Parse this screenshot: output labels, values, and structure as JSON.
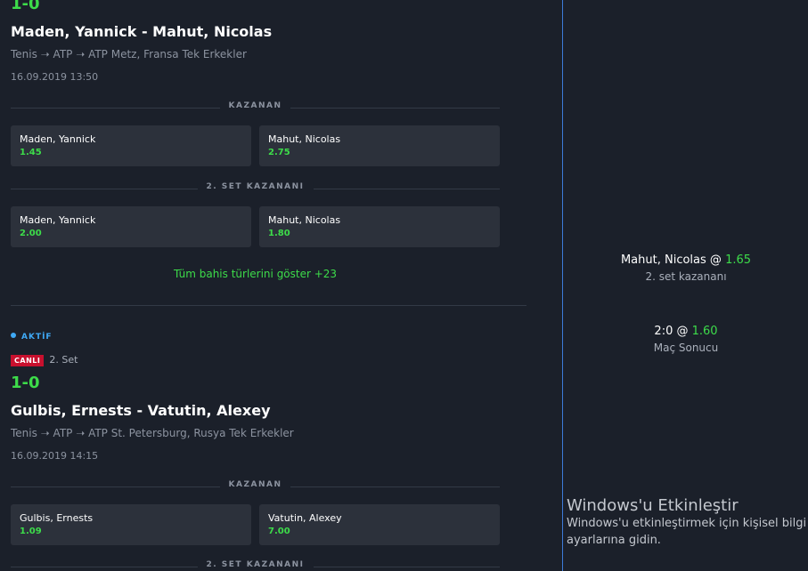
{
  "match1": {
    "score": "1-0",
    "title": "Maden, Yannick - Mahut, Nicolas",
    "breadcrumb": "Tenis ➝ ATP ➝ ATP Metz, Fransa Tek Erkekler",
    "date": "16.09.2019 13:50",
    "markets": [
      {
        "label": "KAZANAN",
        "left": {
          "name": "Maden, Yannick",
          "price": "1.45"
        },
        "right": {
          "name": "Mahut, Nicolas",
          "price": "2.75"
        }
      },
      {
        "label": "2. SET KAZANANI",
        "left": {
          "name": "Maden, Yannick",
          "price": "2.00"
        },
        "right": {
          "name": "Mahut, Nicolas",
          "price": "1.80"
        }
      }
    ],
    "show_all": "Tüm bahis türlerini göster +23"
  },
  "match2": {
    "status": "AKTİF",
    "live_badge": "CANLI",
    "period": "2. Set",
    "score": "1-0",
    "title": "Gulbis, Ernests - Vatutin, Alexey",
    "breadcrumb": "Tenis ➝ ATP ➝ ATP St. Petersburg, Rusya Tek Erkekler",
    "date": "16.09.2019 14:15",
    "markets": [
      {
        "label": "KAZANAN",
        "left": {
          "name": "Gulbis, Ernests",
          "price": "1.09"
        },
        "right": {
          "name": "Vatutin, Alexey",
          "price": "7.00"
        }
      },
      {
        "label": "2. SET KAZANANI"
      }
    ]
  },
  "betslip": [
    {
      "selection": "Mahut, Nicolas @",
      "price": "1.65",
      "market": "2. set kazananı"
    },
    {
      "selection": "2:0 @",
      "price": "1.60",
      "market": "Maç Sonucu"
    }
  ],
  "watermark": {
    "title": "Windows'u Etkinleştir",
    "line1": "Windows'u etkinleştirmek için kişisel bilgi",
    "line2": "ayarlarına gidin."
  },
  "colors": {
    "accent_green": "#3ddc4a",
    "live_red": "#c8102e",
    "active_blue": "#3fa9f5",
    "background": "#1b202a"
  }
}
